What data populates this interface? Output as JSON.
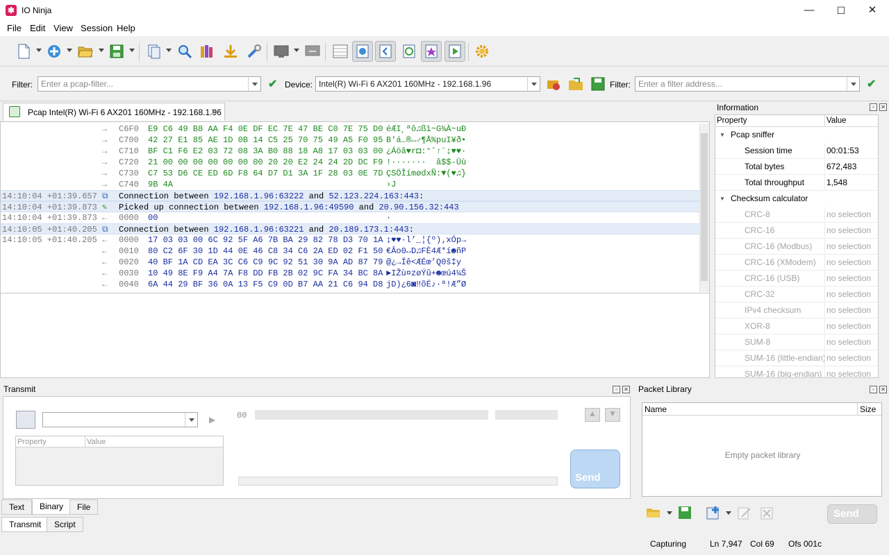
{
  "window": {
    "title": "IO Ninja",
    "minimize": "—",
    "maximize": "☐",
    "close": "✕"
  },
  "menu": [
    "File",
    "Edit",
    "View",
    "Session",
    "Help"
  ],
  "filterbar": {
    "filter_label": "Filter:",
    "pcap_placeholder": "Enter a pcap-filter...",
    "device_label": "Device:",
    "device_value": "Intel(R) Wi-Fi 6 AX201 160MHz - 192.168.1.96",
    "filter2_label": "Filter:",
    "address_placeholder": "Enter a filter address..."
  },
  "session_tab": {
    "title": "Pcap Intel(R) Wi-Fi 6 AX201 160MHz - 192.168.1.96",
    "close": "✕"
  },
  "log": [
    {
      "kind": "tx",
      "ts": "",
      "off": "C6F0",
      "hex": "E9 C6 49 B8 AA F4 0E DF EC 7E 47 BE C0 7E 75 D0",
      "asc": "éÆI¸ªô♫ßì~G¾À~uÐ"
    },
    {
      "kind": "tx",
      "ts": "",
      "off": "C700",
      "hex": "42 27 E1 85 AE 1D 0B 14 C5 25 70 75 49 A5 F0 95",
      "asc": "B'á…®↔♂¶Å%puI¥ð•"
    },
    {
      "kind": "tx",
      "ts": "",
      "off": "C710",
      "hex": "BF C1 F6 E2 03 72 08 3A B0 88 18 A8 17 03 03 00",
      "asc": "¿Áöâ♥r◘:°ˆ↑¨↨♥♥·"
    },
    {
      "kind": "tx",
      "ts": "",
      "off": "C720",
      "hex": "21 00 00 00 00 00 00 00 20 20 E2 24 24 2D DC F9",
      "asc": "!·······  â$$-Üù"
    },
    {
      "kind": "tx",
      "ts": "",
      "off": "C730",
      "hex": "C7 53 D6 CE ED 6D F8 64 D7 D1 3A 1F 28 03 0E 7D",
      "asc": "ÇSÖÎímødxÑ:▼(♥♫}"
    },
    {
      "kind": "tx",
      "ts": "",
      "off": "C740",
      "hex": "9B 4A",
      "asc": "›J"
    },
    {
      "kind": "msg",
      "ts": "14:10:04 +01:39.657",
      "icon": "connect",
      "text": "Connection between ",
      "a": "192.168.1.96:63222",
      "mid": " and ",
      "b": "52.123.224.163:443",
      "end": ":"
    },
    {
      "kind": "msg",
      "ts": "14:10:04 +01:39.873",
      "icon": "pickup",
      "text": "Picked up connection between ",
      "a": "192.168.1.96:49590",
      "mid": " and ",
      "b": "20.90.156.32:443",
      "end": ""
    },
    {
      "kind": "rx",
      "ts": "14:10:04 +01:39.873",
      "off": "0000",
      "hex": "00",
      "asc": "·"
    },
    {
      "kind": "msg",
      "ts": "14:10:05 +01:40.205",
      "icon": "connect",
      "text": "Connection between ",
      "a": "192.168.1.96:63221",
      "mid": " and ",
      "b": "20.189.173.1:443",
      "end": ":"
    },
    {
      "kind": "rx",
      "ts": "14:10:05 +01:40.205",
      "off": "0000",
      "hex": "17 03 03 00 6C 92 5F A6 7B BA 29 82 78 D3 70 1A",
      "asc": "↨♥♥·l’_¦{º)‚xÓp→"
    },
    {
      "kind": "rx",
      "ts": "",
      "off": "0010",
      "hex": "80 C2 6F 30 1D 44 0E 46 C8 34 C6 2A ED 02 F1 50",
      "asc": "€Âo0↔D♫FÈ4Æ*í☻ñP"
    },
    {
      "kind": "rx",
      "ts": "",
      "off": "0020",
      "hex": "40 BF 1A CD EA 3C C6 C9 9C 92 51 30 9A AD 87 79",
      "asc": "@¿→Íê<ÆÉœ’Q0š­‡y"
    },
    {
      "kind": "rx",
      "ts": "",
      "off": "0030",
      "hex": "10 49 8E F9 A4 7A F8 DD FB 2B 02 9C FA 34 BC 8A",
      "asc": "►IŽù¤zøÝû+☻œú4¼Š"
    },
    {
      "kind": "rx",
      "ts": "",
      "off": "0040",
      "hex": "6A 44 29 BF 36 0A 13 F5 C9 0D B7 AA 21 C6 94 D8",
      "asc": "jD)¿6◙‼õÉ♪·ª!Æ”Ø"
    }
  ],
  "info": {
    "title": "Information",
    "col_property": "Property",
    "col_value": "Value",
    "groups": [
      {
        "name": "Pcap sniffer",
        "rows": [
          {
            "p": "Session time",
            "v": "00:01:53"
          },
          {
            "p": "Total bytes",
            "v": "672,483"
          },
          {
            "p": "Total throughput",
            "v": "1,548"
          }
        ]
      },
      {
        "name": "Checksum calculator",
        "rows": [
          {
            "p": "CRC-8",
            "v": "no selection"
          },
          {
            "p": "CRC-16",
            "v": "no selection"
          },
          {
            "p": "CRC-16 (Modbus)",
            "v": "no selection"
          },
          {
            "p": "CRC-16 (XModem)",
            "v": "no selection"
          },
          {
            "p": "CRC-16 (USB)",
            "v": "no selection"
          },
          {
            "p": "CRC-32",
            "v": "no selection"
          },
          {
            "p": "IPv4 checksum",
            "v": "no selection"
          },
          {
            "p": "XOR-8",
            "v": "no selection"
          },
          {
            "p": "SUM-8",
            "v": "no selection"
          },
          {
            "p": "SUM-16 (little-endian)",
            "v": "no selection"
          },
          {
            "p": "SUM-16 (big-endian)",
            "v": "no selection"
          }
        ]
      }
    ]
  },
  "transmit": {
    "title": "Transmit",
    "col_property": "Property",
    "col_value": "Value",
    "offset": "00",
    "send": "Send",
    "mode_tabs": [
      "Text",
      "Binary",
      "File"
    ],
    "mode_active": "Binary",
    "bottom_tabs": [
      "Transmit",
      "Script"
    ],
    "bottom_active": "Transmit"
  },
  "packet_library": {
    "title": "Packet Library",
    "col_name": "Name",
    "col_size": "Size",
    "empty": "Empty packet library",
    "send": "Send"
  },
  "status": {
    "state": "Capturing",
    "ln": "Ln 7,947",
    "col": "Col 69",
    "ofs": "Ofs 001c"
  },
  "colors": {
    "tx": "#1e8a1e",
    "rx": "#1a2ea0",
    "highlight": "#e4ecf8",
    "accent": "#d61f5a"
  }
}
